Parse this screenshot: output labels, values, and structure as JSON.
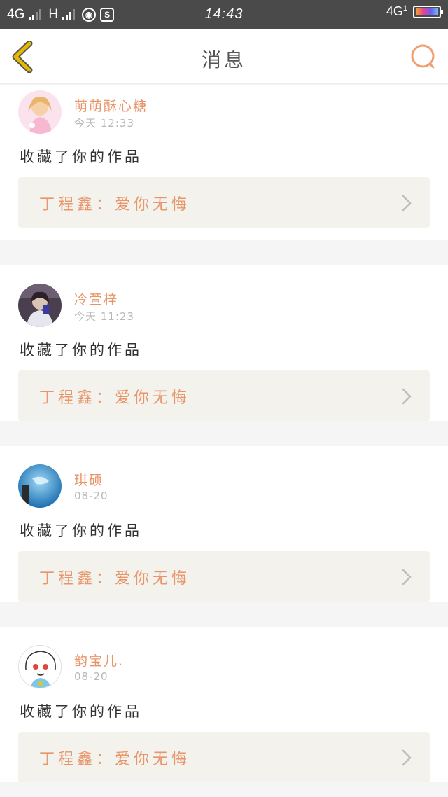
{
  "status_bar": {
    "network_left": "4G",
    "network_mid": "H",
    "sim_icon": "S",
    "time": "14:43",
    "network_right": "4G",
    "network_right_sub": "1"
  },
  "header": {
    "title": "消息",
    "back_icon": "chevron-left-icon",
    "search_icon": "search-icon"
  },
  "messages": [
    {
      "name": "萌萌酥心糖",
      "time": "今天 12:33",
      "action": "收藏了你的作品",
      "work": "丁程鑫：爱你无悔"
    },
    {
      "name": "冷萱梓",
      "time": "今天 11:23",
      "action": "收藏了你的作品",
      "work": "丁程鑫：爱你无悔"
    },
    {
      "name": "琪硕",
      "time": "08-20",
      "action": "收藏了你的作品",
      "work": "丁程鑫：爱你无悔"
    },
    {
      "name": "韵宝儿.",
      "time": "08-20",
      "action": "收藏了你的作品",
      "work": "丁程鑫：爱你无悔"
    }
  ],
  "colors": {
    "accent": "#e8956a",
    "back_arrow": "#e6b800",
    "work_bg": "#f3f2ed"
  }
}
